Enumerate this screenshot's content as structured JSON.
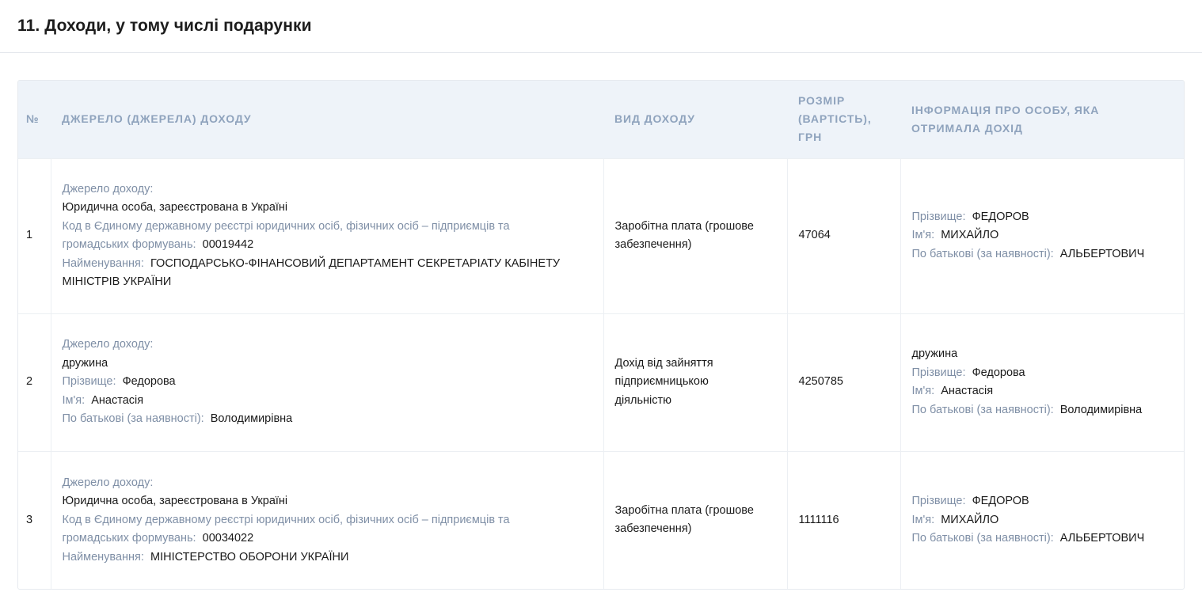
{
  "section": {
    "title": "11. Доходи, у тому числі подарунки"
  },
  "table": {
    "headers": {
      "num": "№",
      "source": "Джерело (джерела) доходу",
      "type": "Вид доходу",
      "amount_line1": "Розмір",
      "amount_line2": "(вартість),",
      "amount_line3": "грн",
      "person_line1": "Інформація про особу, яка",
      "person_line2": "отримала дохід"
    },
    "rows": [
      {
        "num": "1",
        "source_label": "Джерело доходу:",
        "source_value": "Юридична особа, зареєстрована в Україні",
        "code_label_line1": "Код в Єдиному державному реєстрі юридичних осіб, фізичних осіб – підприємців та",
        "code_label_line2": "громадських формувань:",
        "code_value": "00019442",
        "name_label": "Найменування:",
        "name_value_line1": "ГОСПОДАРСЬКО-ФІНАНСОВИЙ ДЕПАРТАМЕНТ СЕКРЕТАРІАТУ КАБІНЕТУ",
        "name_value_line2": "МІНІСТРІВ УКРАЇНИ",
        "type_line1": "Заробітна плата (грошове",
        "type_line2": "забезпечення)",
        "amount": "47064",
        "surname_label": "Прізвище:",
        "surname": "ФЕДОРОВ",
        "firstname_label": "Ім'я:",
        "firstname": "МИХАЙЛО",
        "patronymic_label": "По батькові (за наявності):",
        "patronymic": "АЛЬБЕРТОВИЧ"
      },
      {
        "num": "2",
        "source_label": "Джерело доходу:",
        "source_value": "дружина",
        "surname_label": "Прізвище:",
        "surname": "Федорова",
        "firstname_label": "Ім'я:",
        "firstname": "Анастасія",
        "patronymic_label": "По батькові (за наявності):",
        "patronymic": "Володимирівна",
        "type_line1": "Дохід від зайняття",
        "type_line2": "підприємницькою",
        "type_line3": "діяльністю",
        "amount": "4250785",
        "person_relation": "дружина",
        "person_surname_label": "Прізвище:",
        "person_surname": "Федорова",
        "person_firstname_label": "Ім'я:",
        "person_firstname": "Анастасія",
        "person_patronymic_label": "По батькові (за наявності):",
        "person_patronymic": "Володимирівна"
      },
      {
        "num": "3",
        "source_label": "Джерело доходу:",
        "source_value": "Юридична особа, зареєстрована в Україні",
        "code_label_line1": "Код в Єдиному державному реєстрі юридичних осіб, фізичних осіб – підприємців та",
        "code_label_line2": "громадських формувань:",
        "code_value": "00034022",
        "name_label": "Найменування:",
        "name_value_line1": "МІНІСТЕРСТВО ОБОРОНИ УКРАЇНИ",
        "type_line1": "Заробітна плата (грошове",
        "type_line2": "забезпечення)",
        "amount": "1111116",
        "surname_label": "Прізвище:",
        "surname": "ФЕДОРОВ",
        "firstname_label": "Ім'я:",
        "firstname": "МИХАЙЛО",
        "patronymic_label": "По батькові (за наявності):",
        "patronymic": "АЛЬБЕРТОВИЧ"
      }
    ]
  }
}
